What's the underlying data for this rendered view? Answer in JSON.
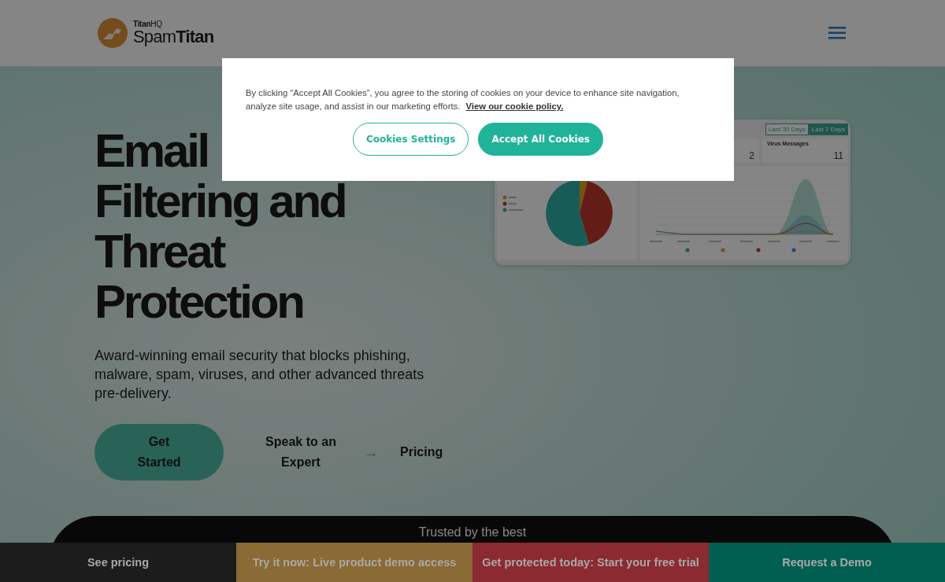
{
  "header": {
    "logo_small": "**Titan**HQ",
    "logo": "Spam**Titan**"
  },
  "hero": {
    "heading_lines": [
      "Email",
      "Filtering and",
      "Threat",
      "Protection"
    ],
    "description": "Award-winning email security that blocks phishing, malware, spam, viruses, and other advanced threats pre-delivery.",
    "primary_button": "Get Started",
    "expert_link": "Speak to an Expert",
    "arrow": "→",
    "pricing_link": "Pricing"
  },
  "dashboard": {
    "tabs": [
      {
        "label": "Last 30 Days",
        "selected": false
      },
      {
        "label": "Last 7 Days",
        "selected": true
      }
    ],
    "stats": [
      {
        "value": "2"
      },
      {
        "label": "Virus Messages",
        "value": "11"
      }
    ]
  },
  "trusted": {
    "title": "Trusted by the best"
  },
  "cookie_banner": {
    "text": "By clicking “Accept All Cookies”, you agree to the storing of cookies on your device to enhance site navigation, analyze site usage, and assist in our marketing efforts.",
    "policy_link": "View our cookie policy.",
    "settings_button": "Cookies Settings",
    "accept_button": "Accept All Cookies"
  },
  "bottom_bar": [
    {
      "label": "See pricing",
      "color": "#1c1c1c"
    },
    {
      "label": "Try it now: Live product demo access",
      "color": "#8a6a35"
    },
    {
      "label": "Get protected today: Start your free trial",
      "color": "#8b2a30"
    },
    {
      "label": "Request a Demo",
      "color": "#005f50"
    }
  ]
}
